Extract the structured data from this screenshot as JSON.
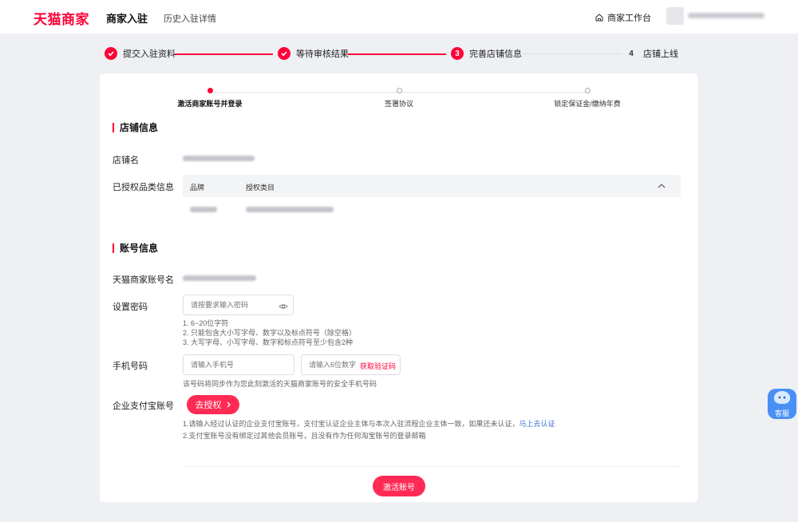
{
  "header": {
    "logo": "天猫商家",
    "title": "商家入驻",
    "history": "历史入驻详情",
    "workbench": "商家工作台"
  },
  "steps": [
    {
      "number": "",
      "label": "提交入驻资料",
      "status": "done"
    },
    {
      "number": "",
      "label": "等待审核结果",
      "status": "done"
    },
    {
      "number": "3",
      "label": "完善店铺信息",
      "status": "current"
    },
    {
      "number": "4",
      "label": "店铺上线",
      "status": "todo"
    }
  ],
  "sub_steps": [
    {
      "label": "激活商家账号并登录",
      "status": "active"
    },
    {
      "label": "签署协议",
      "status": "todo"
    },
    {
      "label": "锁定保证金/缴纳年费",
      "status": "todo"
    }
  ],
  "shop_section": {
    "title": "店铺信息",
    "shop_name_label": "店铺名",
    "category_label": "已授权品类信息",
    "table_headers": {
      "brand": "品牌",
      "category": "授权类目"
    }
  },
  "account_section": {
    "title": "账号信息",
    "account_name_label": "天猫商家账号名",
    "password_label": "设置密码",
    "password_placeholder": "请按要求输入密码",
    "password_rules": [
      "1. 6~20位字符",
      "2. 只能包含大小写字母、数字以及标点符号（除空格）",
      "3. 大写字母、小写字母、数字和标点符号至少包含2种"
    ],
    "phone_label": "手机号码",
    "phone_placeholder": "请输入手机号",
    "code_placeholder": "请输入6位数字",
    "get_code": "获取验证码",
    "phone_hint": "该号码将同步作为您此刻激活的天猫商家账号的安全手机号码",
    "alipay_label": "企业支付宝账号",
    "auth_button": "去授权",
    "alipay_hint_1": "1.请输入经过认证的企业支付宝账号，支付宝认证企业主体与本次入驻流程企业主体一致，如果还未认证，",
    "alipay_hint_1_link": "马上去认证",
    "alipay_hint_2": "2.支付宝账号没有绑定过其他会员账号，且没有作为任何淘宝账号的登录邮箱"
  },
  "activate_button": "激活账号",
  "customer_service": "客服",
  "colors": {
    "accent": "#ff0036",
    "button": "#ff2b54",
    "link": "#3b6fd4"
  }
}
